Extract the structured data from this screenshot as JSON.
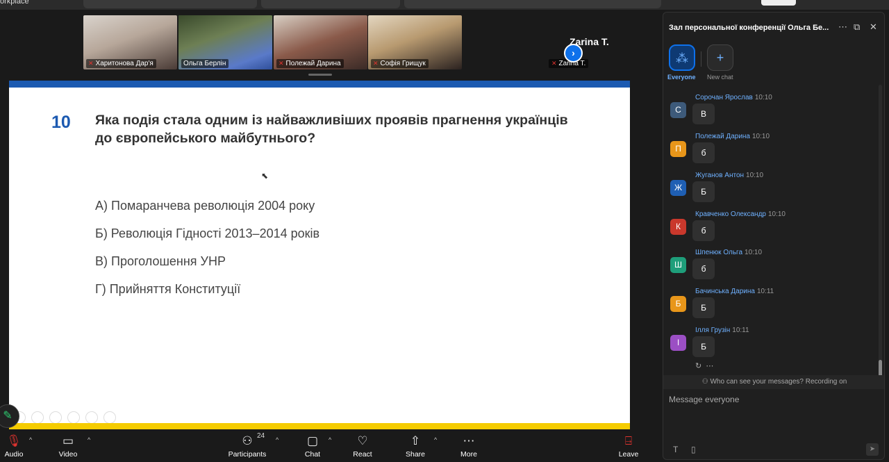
{
  "topbar": {
    "title": "orkplace"
  },
  "participants_strip": [
    {
      "name": "Харитонова Дар'я",
      "muted": true,
      "active": false,
      "bg": "#b7a79a"
    },
    {
      "name": "Ольга Берлін",
      "muted": false,
      "active": true,
      "bg": "#6d7f54"
    },
    {
      "name": "Полежай Дарина",
      "muted": true,
      "active": false,
      "bg": "#8a5a4a"
    },
    {
      "name": "Софія Грищук",
      "muted": true,
      "active": false,
      "bg": "#b89a70"
    }
  ],
  "zarina": {
    "big": "Zarina T.",
    "label": "Zarina T."
  },
  "slide": {
    "number": "10",
    "question": "Яка подія стала одним із найважливіших проявів прагнення українців до європейського майбутнього?",
    "options": [
      "А) Помаранчева революція 2004 року",
      "Б) Революція Гідності 2013–2014 років",
      "В) Проголошення УНР",
      "Г) Прийняття Конституції"
    ]
  },
  "toolbar": {
    "audio": "Audio",
    "video": "Video",
    "participants": "Participants",
    "participants_count": "24",
    "chat": "Chat",
    "react": "React",
    "share": "Share",
    "more": "More",
    "leave": "Leave"
  },
  "chat": {
    "title": "Зал персональної конференції Ольга Бе...",
    "tab_everyone": "Everyone",
    "tab_new": "New chat",
    "messages": [
      {
        "initial": "С",
        "color": "#3d5a7a",
        "sender": "Сорочан Ярослав",
        "time": "10:10",
        "text": "В"
      },
      {
        "initial": "П",
        "color": "#e8961a",
        "sender": "Полежай Дарина",
        "time": "10:10",
        "text": "б"
      },
      {
        "initial": "Ж",
        "color": "#1f5fb3",
        "sender": "Жуганов Антон",
        "time": "10:10",
        "text": "Б"
      },
      {
        "initial": "К",
        "color": "#c9382c",
        "sender": "Кравченко Олександр",
        "time": "10:10",
        "text": "б"
      },
      {
        "initial": "Ш",
        "color": "#1e9e7a",
        "sender": "Шпенюк Ольга",
        "time": "10:10",
        "text": "б"
      },
      {
        "initial": "Б",
        "color": "#e8961a",
        "sender": "Бачинська Дарина",
        "time": "10:11",
        "text": "Б"
      },
      {
        "initial": "І",
        "color": "#9b4fc4",
        "sender": "Ілля Грузін",
        "time": "10:11",
        "text": "Б"
      }
    ],
    "notice": "Who can see your messages? Recording on",
    "input_placeholder": "Message everyone"
  }
}
